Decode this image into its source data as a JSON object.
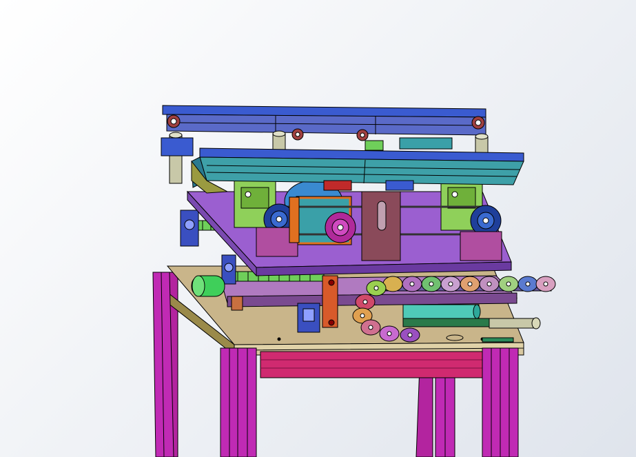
{
  "scene": {
    "background_colors": [
      "#ffffff",
      "#dfe4ec"
    ],
    "palette": {
      "frame_legs": "#c02ab4",
      "table_top": "#c9b58a",
      "top_conveyor_rail": "#3a5bd0",
      "conveyor_body": "#3ea0a8",
      "mid_plate": "#9b5fd0",
      "motor_mount": "#b04ea0",
      "pulley": "#1f3f9a",
      "stepper": "#8fd05a",
      "cable_chain": "#d07090",
      "roller": "#4fcab8",
      "ball_screw": "#6fcf5a",
      "bearing_block": "#3a4fc0",
      "standoff": "#c8c8a8",
      "edge": "#000000"
    },
    "components": [
      "frame-leg",
      "table-top",
      "apron-rail",
      "top-conveyor",
      "lower-conveyor",
      "carrier-plate",
      "stepper-motor",
      "timing-pulley",
      "timing-belt",
      "motor-mount",
      "ball-screw",
      "bearing-block",
      "cable-chain",
      "roller",
      "standoff-post"
    ]
  }
}
